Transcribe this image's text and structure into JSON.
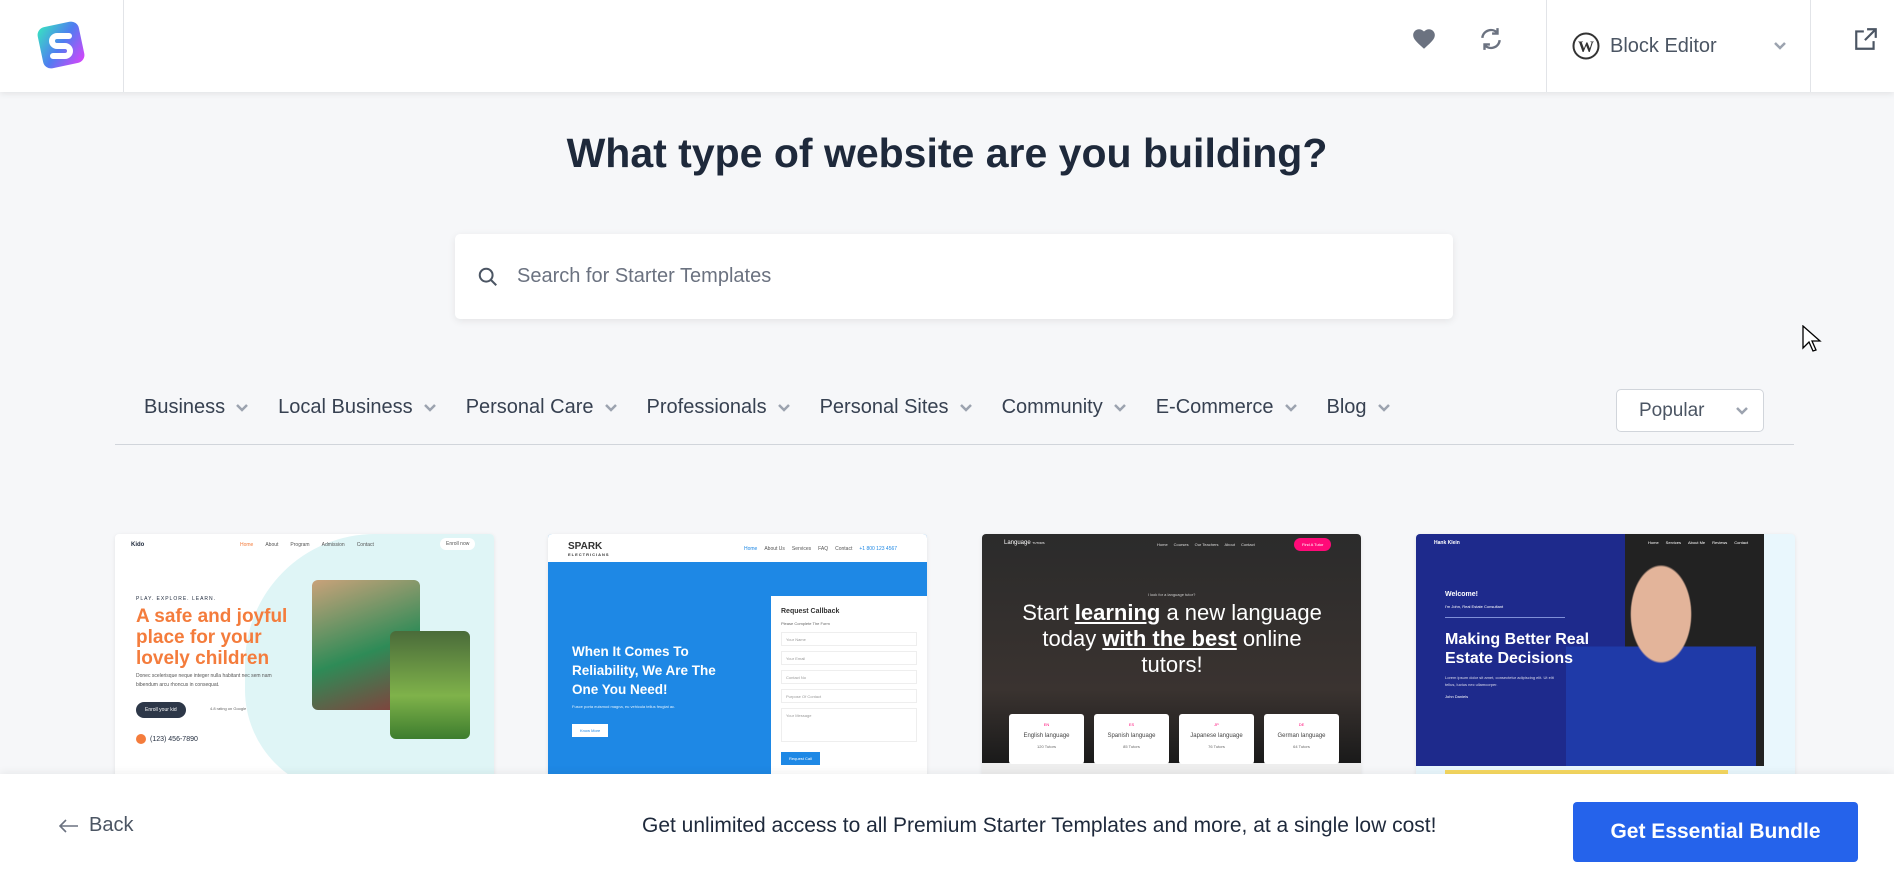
{
  "header": {
    "editor_label": "Block Editor",
    "icons": [
      "favorites-heart-icon",
      "sync-icon",
      "wordpress-icon",
      "chevron-down-icon",
      "external-link-icon"
    ]
  },
  "main": {
    "title": "What type of website are you building?",
    "search_placeholder": "Search for Starter Templates"
  },
  "categories": [
    {
      "label": "Business"
    },
    {
      "label": "Local Business"
    },
    {
      "label": "Personal Care"
    },
    {
      "label": "Professionals"
    },
    {
      "label": "Personal Sites"
    },
    {
      "label": "Community"
    },
    {
      "label": "E-Commerce"
    },
    {
      "label": "Blog"
    }
  ],
  "sort": {
    "selected": "Popular"
  },
  "templates": [
    {
      "brand": "Kido",
      "nav": [
        "Home",
        "About",
        "Program",
        "Admission",
        "Contact"
      ],
      "button": "Enroll now",
      "eyebrow": "PLAY. EXPLORE. LEARN.",
      "headline": "A safe and joyful place for your lovely children",
      "body": "Donec scelerisque neque integer nulla habitant nec sem nam bibendum arcu rhoncus in consequat.",
      "cta": "Enroll your kid",
      "rating": "4.8 rating on Google",
      "phone": "(123) 456-7890",
      "accent": "#f47c3c"
    },
    {
      "brand": "SPARK",
      "sub": "ELECTRICIANS",
      "nav": [
        "Home",
        "About Us",
        "Services",
        "FAQ",
        "Contact",
        "+1 800 123 4567"
      ],
      "headline": "When It Comes To Reliability, We Are The One You Need!",
      "body": "Fusce porta euismod magna, eu vehicula tellus feugiat ac.",
      "cta": "Know More",
      "form_title": "Request Callback",
      "form_sub": "Please Complete The Form",
      "fields": [
        "Your Name",
        "Your Email",
        "Contact No",
        "Purpose Of Contact",
        "Your Message"
      ],
      "submit": "Request Call",
      "accent": "#1e88e5"
    },
    {
      "brand": "Language",
      "sub": "TUTORS",
      "nav": [
        "Home",
        "Courses",
        "Our Teachers",
        "About",
        "Contact"
      ],
      "button": "Find A Tutor",
      "eyebrow": "I look for a language tutor?",
      "headline_parts": [
        "Start ",
        "learning",
        " a new language today ",
        "with the best",
        " online tutors!"
      ],
      "langs": [
        {
          "code": "EN",
          "name": "English language",
          "count": "120 Tutors"
        },
        {
          "code": "ES",
          "name": "Spanish language",
          "count": "85 Tutors"
        },
        {
          "code": "JP",
          "name": "Japanese language",
          "count": "76 Tutors"
        },
        {
          "code": "DE",
          "name": "German language",
          "count": "64 Tutors"
        }
      ],
      "accent": "#ff0a78"
    },
    {
      "brand": "Hank Klein",
      "nav": [
        "Home",
        "Services",
        "About Me",
        "Reviews",
        "Contact"
      ],
      "eyebrow": "Welcome!",
      "sub": "I'm John, Real Estate Consultant",
      "headline": "Making Better Real Estate Decisions",
      "body": "Lorem ipsum dolor sit amet, consectetur adipiscing elit. Ut elit tellus, luctus nec ullamcorper.",
      "name": "John Daniels",
      "accent": "#1e2a8c"
    }
  ],
  "footer": {
    "back_label": "Back",
    "promo": "Get unlimited access to all Premium Starter Templates and more, at a single low cost!",
    "cta": "Get Essential Bundle",
    "cta_color": "#2563eb"
  }
}
